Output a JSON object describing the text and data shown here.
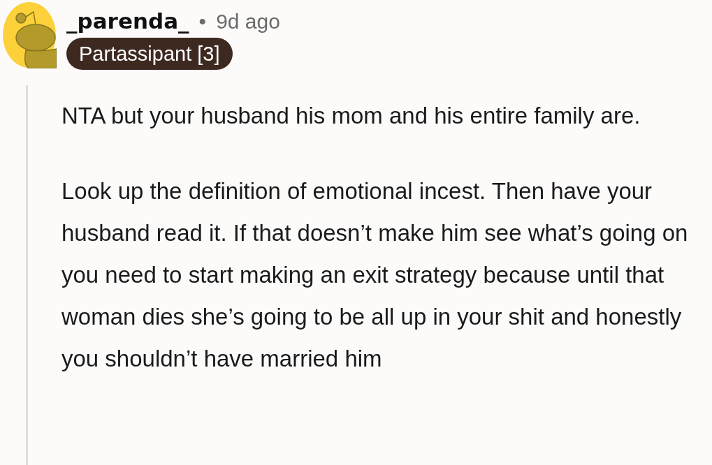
{
  "comment": {
    "author": "_parenda_",
    "separator": "•",
    "time": "9d ago",
    "flair": "Partassipant [3]",
    "paragraphs": [
      "NTA but your husband his mom and his entire family are.",
      "Look up the definition of emotional incest. Then have your husband read it. If that doesn’t make him see what’s going on you need to start making an exit strategy because until that woman dies she’s going to be all up in your shit and honestly you shouldn’t have married him"
    ]
  }
}
